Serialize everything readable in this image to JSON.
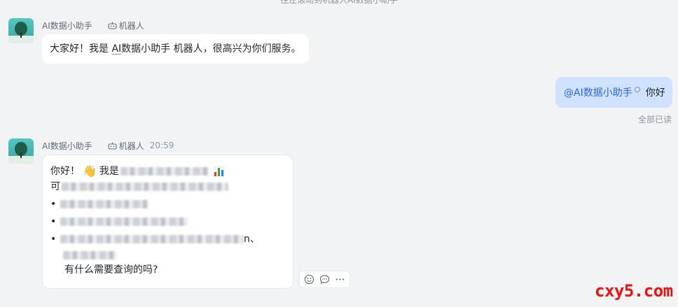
{
  "top_hint": "往左滚动到机器人AI数据小助手",
  "bot": {
    "name": "AI数据小助手",
    "tag": "机器人"
  },
  "msg1": {
    "prefix": "大家好！我是 ",
    "mention": "AI",
    "suffix": "数据小助手 机器人，很高兴为你们服务。"
  },
  "me_msg": {
    "mention": "@AI数据小助手",
    "text": "你好"
  },
  "read_status": "全部已读",
  "msg2": {
    "time": "20:59",
    "greeting": "你好！",
    "wave": "👋",
    "intro": "我是",
    "line2_start": "可",
    "bullet": "•",
    "bullet3_tail": "n、",
    "closing": "有什么需要查询的吗?"
  },
  "icons": {
    "actions": [
      "reaction-icon",
      "reply-icon",
      "more-icon"
    ],
    "chart_emoji_colors": [
      "#e53935",
      "#43a047",
      "#1e88e5",
      "#1e88e5"
    ]
  },
  "watermark": "cxy5.com"
}
